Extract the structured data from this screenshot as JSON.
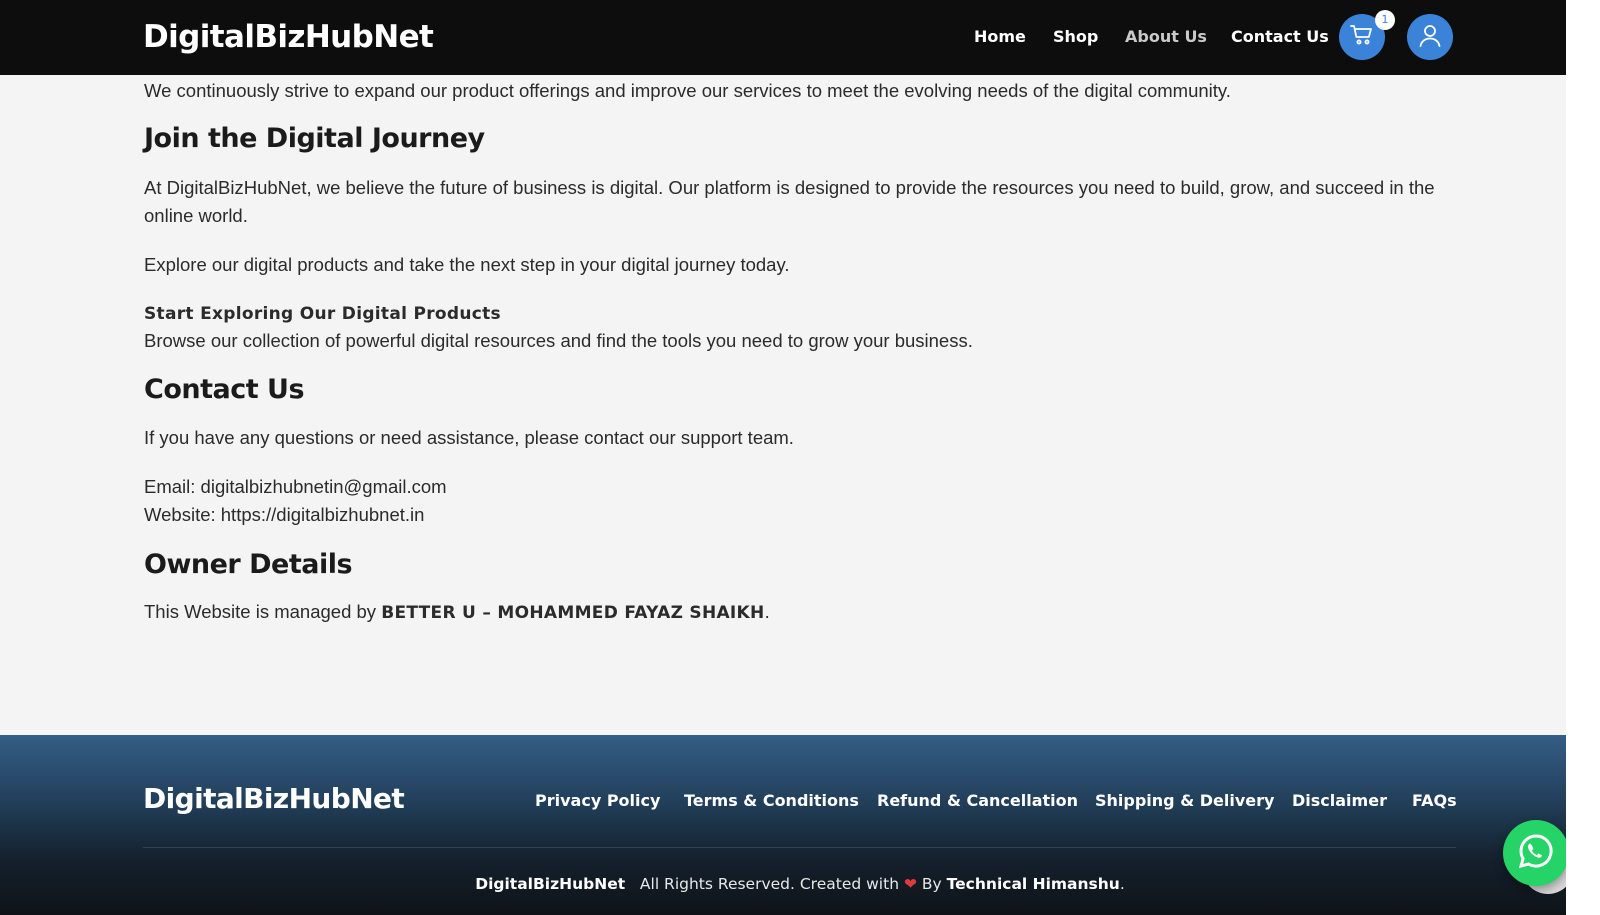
{
  "header": {
    "brand": "DigitalBizHubNet",
    "nav": [
      "Home",
      "Shop",
      "About Us",
      "Contact Us"
    ],
    "active_nav": "About Us",
    "cart_count": "1",
    "colors": {
      "bar": "#0d0d0d",
      "accent": "#3b82d9"
    },
    "icons": [
      "cart-icon",
      "user-icon"
    ]
  },
  "content": {
    "intro": "We continuously strive to expand our product offerings and improve our services to meet the evolving needs of the digital community.",
    "journey": {
      "heading": "Join the Digital Journey",
      "para1_line1": "At DigitalBizHubNet, we believe the future of business is digital. Our platform is designed to provide the resources you need to build, grow, and succeed in the",
      "para1_line2": "online world.",
      "para2": "Explore our digital products and take the next step in your digital journey today.",
      "cta_title": "Start Exploring Our Digital Products",
      "cta_text": "Browse our collection of powerful digital resources and find the tools you need to grow your business."
    },
    "contact": {
      "heading": "Contact Us",
      "text": "If you have any questions or need assistance, please contact our support team.",
      "email": "Email: digitalbizhubnetin@gmail.com",
      "website": "Website: https://digitalbizhubnet.in"
    },
    "owner": {
      "heading": "Owner Details",
      "prefix": "This Website is managed by ",
      "name": "BETTER U – MOHAMMED FAYAZ SHAIKH",
      "suffix": "."
    }
  },
  "footer": {
    "brand": "DigitalBizHubNet",
    "links": [
      "Privacy Policy",
      "Terms & Conditions",
      "Refund & Cancellation",
      "Shipping & Delivery",
      "Disclaimer",
      "FAQs"
    ],
    "copyright_brand": "DigitalBizHubNet",
    "copyright_mid": "All Rights Reserved. Created with",
    "heart": "❤",
    "copyright_by": "By",
    "author": "Technical Himanshu",
    "period": ".",
    "icons": [
      "whatsapp-icon"
    ]
  }
}
